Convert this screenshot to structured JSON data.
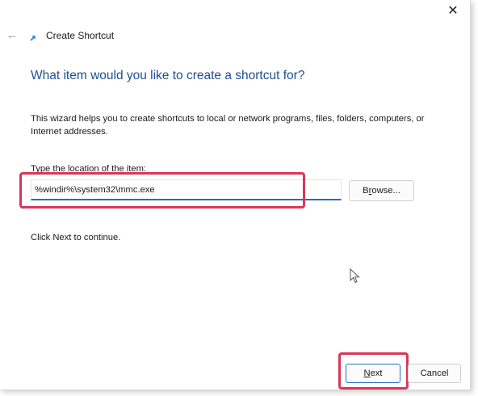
{
  "window": {
    "close_glyph": "✕",
    "back_glyph": "←",
    "title": "Create Shortcut"
  },
  "wizard": {
    "heading": "What item would you like to create a shortcut for?",
    "description": "This wizard helps you to create shortcuts to local or network programs, files, folders, computers, or Internet addresses.",
    "location_label_mnemonic": "T",
    "location_label_rest": "ype the location of the item:",
    "location_value": "%windir%\\system32\\mmc.exe",
    "browse_mnemonic": "r",
    "browse_before": "B",
    "browse_after": "owse...",
    "continue_text": "Click Next to continue."
  },
  "footer": {
    "next_mnemonic": "N",
    "next_rest": "ext",
    "cancel_label": "Cancel"
  },
  "colors": {
    "heading": "#1d4f91",
    "accent": "#1f6fc4",
    "highlight": "#d9365b"
  },
  "icons": {
    "close": "close-icon",
    "back": "back-arrow-icon",
    "wizard": "shortcut-wizard-icon",
    "cursor": "mouse-pointer-icon"
  }
}
